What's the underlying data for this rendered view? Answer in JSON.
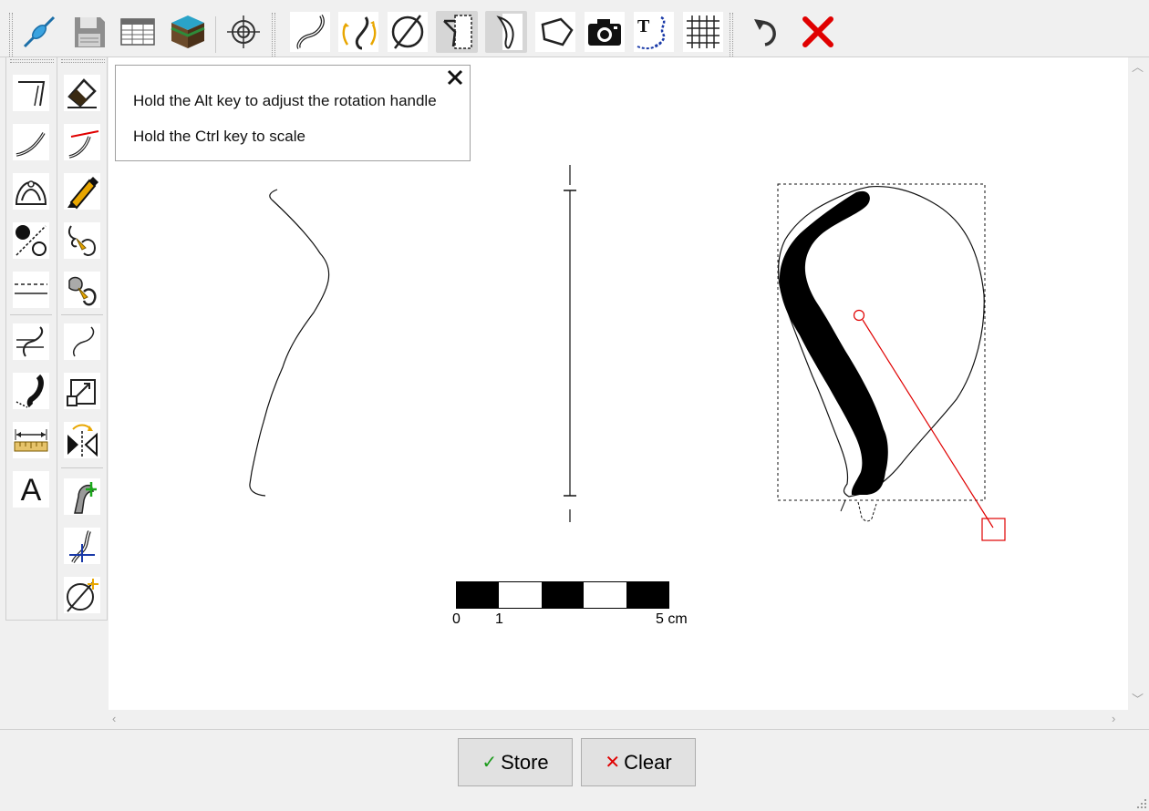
{
  "toolbar": {
    "items": [
      {
        "id": "pin",
        "icon": "probe-pin-icon"
      },
      {
        "id": "save",
        "icon": "floppy-disk-icon"
      },
      {
        "id": "table",
        "icon": "table-grid-icon"
      },
      {
        "id": "layers",
        "icon": "soil-layers-icon"
      },
      {
        "id": "target",
        "icon": "crosshair-target-icon"
      },
      {
        "id": "curve",
        "icon": "profile-curve-icon"
      },
      {
        "id": "rotate-curve",
        "icon": "rotate-profile-icon"
      },
      {
        "id": "diameter",
        "icon": "diameter-icon"
      },
      {
        "id": "select-profile",
        "icon": "select-profile-icon"
      },
      {
        "id": "outline",
        "icon": "outline-icon"
      },
      {
        "id": "polygon",
        "icon": "polygon-icon"
      },
      {
        "id": "camera",
        "icon": "camera-icon"
      },
      {
        "id": "text-path",
        "icon": "text-on-path-icon"
      },
      {
        "id": "grid",
        "icon": "grid-icon"
      },
      {
        "id": "undo",
        "icon": "undo-icon"
      },
      {
        "id": "delete",
        "icon": "delete-x-icon"
      }
    ]
  },
  "left_tools": [
    {
      "icon": "rim-profile-icon"
    },
    {
      "icon": "eraser-icon"
    },
    {
      "icon": "curve-segment-icon"
    },
    {
      "icon": "trim-curve-icon"
    },
    {
      "icon": "handle-lug-icon"
    },
    {
      "icon": "pencil-icon"
    },
    {
      "icon": "dot-circle-split-icon"
    },
    {
      "icon": "fill-outline-icon"
    },
    {
      "icon": "dashed-line-icon"
    },
    {
      "icon": "fill-shape-icon"
    },
    {
      "icon": "profile-join-icon"
    },
    {
      "icon": "s-curve-icon"
    },
    {
      "icon": "thick-profile-icon"
    },
    {
      "icon": "scale-box-icon"
    },
    {
      "icon": "measure-ruler-icon"
    },
    {
      "icon": "mirror-flip-icon"
    },
    {
      "icon": "text-tool-icon",
      "text": "A"
    },
    {
      "icon": "add-point-icon"
    },
    {
      "icon": "axis-point-icon"
    },
    {
      "icon": "diameter-add-icon"
    }
  ],
  "hint": {
    "line1": "Hold the Alt key to adjust the rotation handle",
    "line2": "Hold the Ctrl key to scale"
  },
  "scale": {
    "label_0": "0",
    "label_1": "1",
    "label_5": "5 cm"
  },
  "buttons": {
    "store_icon": "✓",
    "store_label": "Store",
    "clear_icon": "✕",
    "clear_label": "Clear"
  },
  "colors": {
    "accent_red": "#e00000",
    "selection": "#000000",
    "store_check": "#1a9a1a"
  }
}
